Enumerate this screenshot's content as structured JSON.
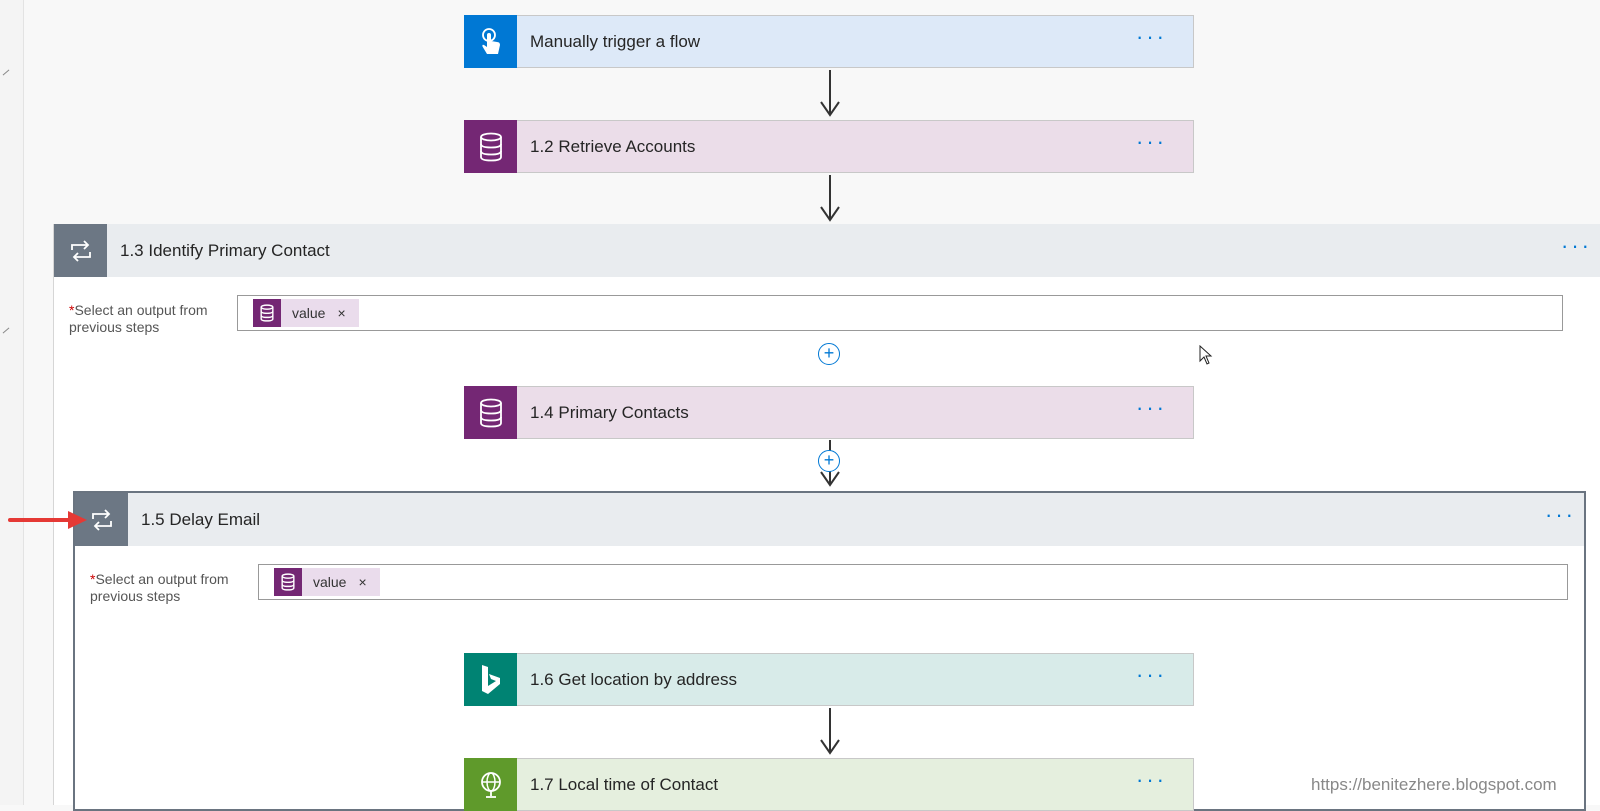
{
  "steps": {
    "trigger": {
      "title": "Manually trigger a flow",
      "menu": "···",
      "color": "#0078d4",
      "bg": "#dde9f8",
      "icon": "hand-tap-icon"
    },
    "retrieve": {
      "title": "1.2 Retrieve Accounts",
      "menu": "···",
      "color": "#742774",
      "bg": "#ebdde9",
      "icon": "database-icon"
    },
    "identify": {
      "title": "1.3 Identify Primary Contact",
      "menu": "···",
      "icon": "loop-icon",
      "label_req": "*",
      "label": "Select an output from previous steps",
      "token": {
        "label": "value",
        "close": "×"
      }
    },
    "primary_contacts": {
      "title": "1.4 Primary Contacts",
      "menu": "···",
      "color": "#742774",
      "bg": "#ebdde9",
      "icon": "database-icon"
    },
    "delay": {
      "title": "1.5 Delay Email",
      "menu": "···",
      "icon": "loop-icon",
      "label_req": "*",
      "label": "Select an output from previous steps",
      "token": {
        "label": "value",
        "close": "×"
      }
    },
    "location": {
      "title": "1.6 Get location by address",
      "menu": "···",
      "color": "#008373",
      "bg": "#d8ebe9",
      "icon": "bing-icon"
    },
    "local_time": {
      "title": "1.7 Local time of Contact",
      "menu": "···",
      "color": "#5f9a2b",
      "bg": "#e5efde",
      "icon": "globe-icon"
    }
  },
  "add_step": "+",
  "watermark": "https://benitezhere.blogspot.com",
  "colors": {
    "accent": "#0078d4",
    "arrow_annotation": "#e53935"
  }
}
